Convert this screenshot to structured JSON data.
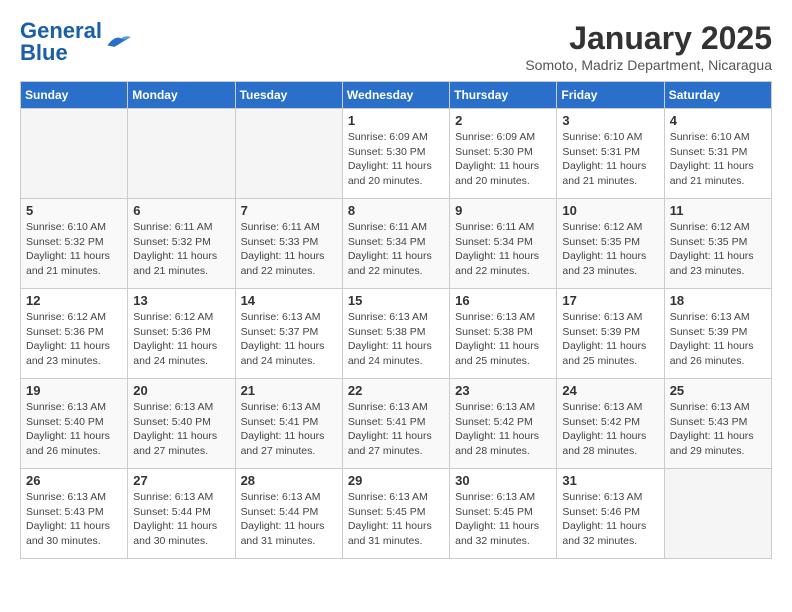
{
  "header": {
    "logo_general": "General",
    "logo_blue": "Blue",
    "month_title": "January 2025",
    "subtitle": "Somoto, Madriz Department, Nicaragua"
  },
  "weekdays": [
    "Sunday",
    "Monday",
    "Tuesday",
    "Wednesday",
    "Thursday",
    "Friday",
    "Saturday"
  ],
  "weeks": [
    [
      {
        "day": "",
        "info": ""
      },
      {
        "day": "",
        "info": ""
      },
      {
        "day": "",
        "info": ""
      },
      {
        "day": "1",
        "info": "Sunrise: 6:09 AM\nSunset: 5:30 PM\nDaylight: 11 hours\nand 20 minutes."
      },
      {
        "day": "2",
        "info": "Sunrise: 6:09 AM\nSunset: 5:30 PM\nDaylight: 11 hours\nand 20 minutes."
      },
      {
        "day": "3",
        "info": "Sunrise: 6:10 AM\nSunset: 5:31 PM\nDaylight: 11 hours\nand 21 minutes."
      },
      {
        "day": "4",
        "info": "Sunrise: 6:10 AM\nSunset: 5:31 PM\nDaylight: 11 hours\nand 21 minutes."
      }
    ],
    [
      {
        "day": "5",
        "info": "Sunrise: 6:10 AM\nSunset: 5:32 PM\nDaylight: 11 hours\nand 21 minutes."
      },
      {
        "day": "6",
        "info": "Sunrise: 6:11 AM\nSunset: 5:32 PM\nDaylight: 11 hours\nand 21 minutes."
      },
      {
        "day": "7",
        "info": "Sunrise: 6:11 AM\nSunset: 5:33 PM\nDaylight: 11 hours\nand 22 minutes."
      },
      {
        "day": "8",
        "info": "Sunrise: 6:11 AM\nSunset: 5:34 PM\nDaylight: 11 hours\nand 22 minutes."
      },
      {
        "day": "9",
        "info": "Sunrise: 6:11 AM\nSunset: 5:34 PM\nDaylight: 11 hours\nand 22 minutes."
      },
      {
        "day": "10",
        "info": "Sunrise: 6:12 AM\nSunset: 5:35 PM\nDaylight: 11 hours\nand 23 minutes."
      },
      {
        "day": "11",
        "info": "Sunrise: 6:12 AM\nSunset: 5:35 PM\nDaylight: 11 hours\nand 23 minutes."
      }
    ],
    [
      {
        "day": "12",
        "info": "Sunrise: 6:12 AM\nSunset: 5:36 PM\nDaylight: 11 hours\nand 23 minutes."
      },
      {
        "day": "13",
        "info": "Sunrise: 6:12 AM\nSunset: 5:36 PM\nDaylight: 11 hours\nand 24 minutes."
      },
      {
        "day": "14",
        "info": "Sunrise: 6:13 AM\nSunset: 5:37 PM\nDaylight: 11 hours\nand 24 minutes."
      },
      {
        "day": "15",
        "info": "Sunrise: 6:13 AM\nSunset: 5:38 PM\nDaylight: 11 hours\nand 24 minutes."
      },
      {
        "day": "16",
        "info": "Sunrise: 6:13 AM\nSunset: 5:38 PM\nDaylight: 11 hours\nand 25 minutes."
      },
      {
        "day": "17",
        "info": "Sunrise: 6:13 AM\nSunset: 5:39 PM\nDaylight: 11 hours\nand 25 minutes."
      },
      {
        "day": "18",
        "info": "Sunrise: 6:13 AM\nSunset: 5:39 PM\nDaylight: 11 hours\nand 26 minutes."
      }
    ],
    [
      {
        "day": "19",
        "info": "Sunrise: 6:13 AM\nSunset: 5:40 PM\nDaylight: 11 hours\nand 26 minutes."
      },
      {
        "day": "20",
        "info": "Sunrise: 6:13 AM\nSunset: 5:40 PM\nDaylight: 11 hours\nand 27 minutes."
      },
      {
        "day": "21",
        "info": "Sunrise: 6:13 AM\nSunset: 5:41 PM\nDaylight: 11 hours\nand 27 minutes."
      },
      {
        "day": "22",
        "info": "Sunrise: 6:13 AM\nSunset: 5:41 PM\nDaylight: 11 hours\nand 27 minutes."
      },
      {
        "day": "23",
        "info": "Sunrise: 6:13 AM\nSunset: 5:42 PM\nDaylight: 11 hours\nand 28 minutes."
      },
      {
        "day": "24",
        "info": "Sunrise: 6:13 AM\nSunset: 5:42 PM\nDaylight: 11 hours\nand 28 minutes."
      },
      {
        "day": "25",
        "info": "Sunrise: 6:13 AM\nSunset: 5:43 PM\nDaylight: 11 hours\nand 29 minutes."
      }
    ],
    [
      {
        "day": "26",
        "info": "Sunrise: 6:13 AM\nSunset: 5:43 PM\nDaylight: 11 hours\nand 30 minutes."
      },
      {
        "day": "27",
        "info": "Sunrise: 6:13 AM\nSunset: 5:44 PM\nDaylight: 11 hours\nand 30 minutes."
      },
      {
        "day": "28",
        "info": "Sunrise: 6:13 AM\nSunset: 5:44 PM\nDaylight: 11 hours\nand 31 minutes."
      },
      {
        "day": "29",
        "info": "Sunrise: 6:13 AM\nSunset: 5:45 PM\nDaylight: 11 hours\nand 31 minutes."
      },
      {
        "day": "30",
        "info": "Sunrise: 6:13 AM\nSunset: 5:45 PM\nDaylight: 11 hours\nand 32 minutes."
      },
      {
        "day": "31",
        "info": "Sunrise: 6:13 AM\nSunset: 5:46 PM\nDaylight: 11 hours\nand 32 minutes."
      },
      {
        "day": "",
        "info": ""
      }
    ]
  ]
}
